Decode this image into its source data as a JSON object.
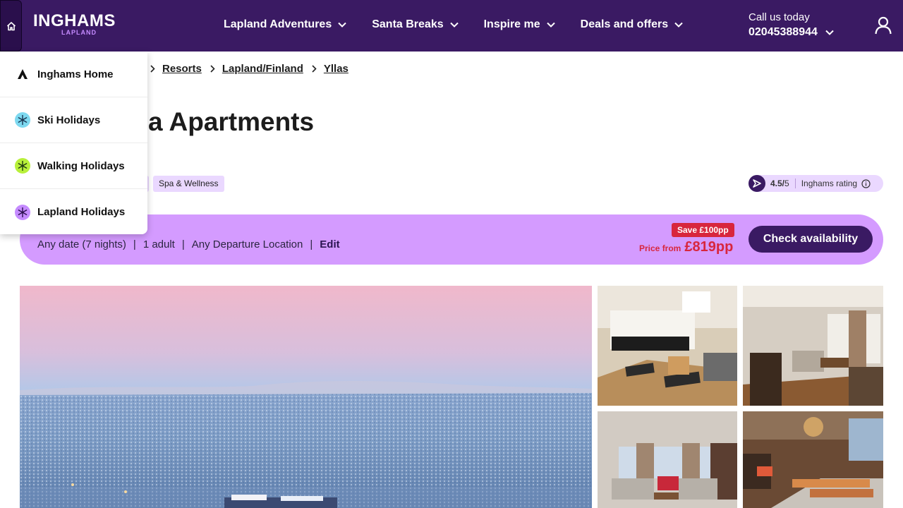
{
  "header": {
    "logo_main": "INGHAMS",
    "logo_sub": "LAPLAND",
    "nav": [
      {
        "label": "Lapland Adventures"
      },
      {
        "label": "Santa Breaks"
      },
      {
        "label": "Inspire me"
      },
      {
        "label": "Deals and offers"
      }
    ],
    "call_label": "Call us today",
    "call_number": "02045388944",
    "icons": {
      "home": "home-icon",
      "user": "user-icon",
      "dropdown": "chevron-down-icon"
    }
  },
  "home_menu": {
    "items": [
      {
        "label": "Inghams Home",
        "icon": "inghams-logo-icon",
        "color": "#111111"
      },
      {
        "label": "Ski Holidays",
        "icon": "snowflake-icon",
        "color": "#7ed9f0"
      },
      {
        "label": "Walking Holidays",
        "icon": "snowflake-icon",
        "color": "#b8f03a"
      },
      {
        "label": "Lapland Holidays",
        "icon": "snowflake-icon",
        "color": "#c58bff"
      }
    ]
  },
  "breadcrumb": {
    "items": [
      "Resorts",
      "Lapland/Finland",
      "Yllas"
    ]
  },
  "page": {
    "title": "a Apartments",
    "tag": "Spa & Wellness"
  },
  "rating": {
    "score": "4.5/",
    "out_of": "5",
    "label": "Inghams rating"
  },
  "search": {
    "date": "Any date (7 nights)",
    "guests": "1 adult",
    "departure": "Any Departure Location",
    "separator": "|",
    "edit_label": "Edit",
    "save_badge": "Save £100pp",
    "price_label": "Price from",
    "price_value": "£819pp",
    "cta_label": "Check availability"
  },
  "colors": {
    "header_bg": "#3a1a63",
    "search_bg": "#d49bff",
    "accent_red": "#d8263d",
    "tag_bg": "#ead8ff"
  }
}
